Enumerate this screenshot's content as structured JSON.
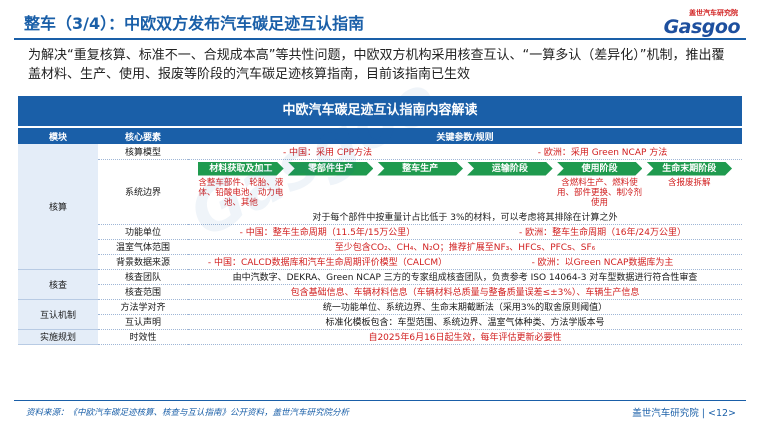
{
  "slide": {
    "title": "整车（3/4）：中欧双方发布汽车碳足迹互认指南",
    "intro": "为解决“重复核算、标准不一、合规成本高”等共性问题，中欧双方机构采用核查互认、“一算多认（差异化）”机制，推出覆盖材料、生产、使用、报废等阶段的汽车碳足迹核算指南，目前该指南已生效"
  },
  "logo": {
    "cn": "盖世汽车研究院",
    "en": "Gasgoo"
  },
  "watermark": "Gasgoo",
  "table": {
    "title": "中欧汽车碳足迹互认指南内容解读",
    "headers": {
      "module": "模块",
      "element": "核心要素",
      "params": "关键参数/规则"
    },
    "rows": {
      "r1": {
        "module": "",
        "element": "核算模型",
        "cn": "- 中国：采用 CPP方法",
        "eu": "- 欧洲：采用 Green NCAP 方法"
      },
      "r2": {
        "module": "核算",
        "element": "系统边界",
        "stages": [
          "材料获取及加工",
          "零部件生产",
          "整车生产",
          "运输阶段",
          "使用阶段",
          "生命末期阶段"
        ],
        "notes": [
          "含整车部件、轮胎、液体、铅酸电池、动力电池、其他",
          "",
          "",
          "",
          "含燃料生产、燃料使用、部件更换、制冷剂使用",
          "含报废拆解"
        ],
        "exclude": "对于每个部件中按重量计占比低于 3%的材料，可以考虑将其排除在计算之外"
      },
      "r3": {
        "module": "",
        "element": "功能单位",
        "cn": "- 中国：整车生命周期（11.5年/15万公里）",
        "eu": "- 欧洲：整车生命周期（16年/24万公里）"
      },
      "r4": {
        "module": "",
        "element": "温室气体范围",
        "text": "至少包含CO₂、CH₄、N₂O；推荐扩展至NF₃、HFCs、PFCs、SF₆"
      },
      "r5": {
        "module": "",
        "element": "背景数据来源",
        "cn": "- 中国：CALCD数据库和汽车生命周期评价模型（CALCM）",
        "eu": "- 欧洲：以Green NCAP数据库为主"
      },
      "r6": {
        "module": "核查",
        "element": "核查团队",
        "text": "由中汽数字、DEKRA、Green NCAP 三方的专家组成核查团队，负责参考 ISO 14064-3 对车型数据进行符合性审查"
      },
      "r7": {
        "module": "",
        "element": "核查范围",
        "text": "包含基础信息、车辆材料信息（车辆材料总质量与整备质量误差≤±3%）、车辆生产信息"
      },
      "r8": {
        "module": "互认机制",
        "element": "方法学对齐",
        "text": "统一功能单位、系统边界、生命末期截断法（采用3%的取舍原则阈值）"
      },
      "r9": {
        "module": "",
        "element": "互认声明",
        "text": "标准化模板包含：车型范围、系统边界、温室气体种类、方法学版本号"
      },
      "r10": {
        "module": "实施规划",
        "element": "时效性",
        "text": "自2025年6月16日起生效，每年评估更新必要性"
      }
    }
  },
  "footer": {
    "source": "资料来源：《中欧汽车碳足迹核算、核查与互认指南》公开资料，盖世汽车研究院分析",
    "org": "盖世汽车研究院  | <12>"
  },
  "colors": {
    "primary": "#1a5fa8",
    "accent_red": "#d11f1f",
    "stage_green": "#1f9a4e",
    "module_bg": "#e4edf8"
  }
}
